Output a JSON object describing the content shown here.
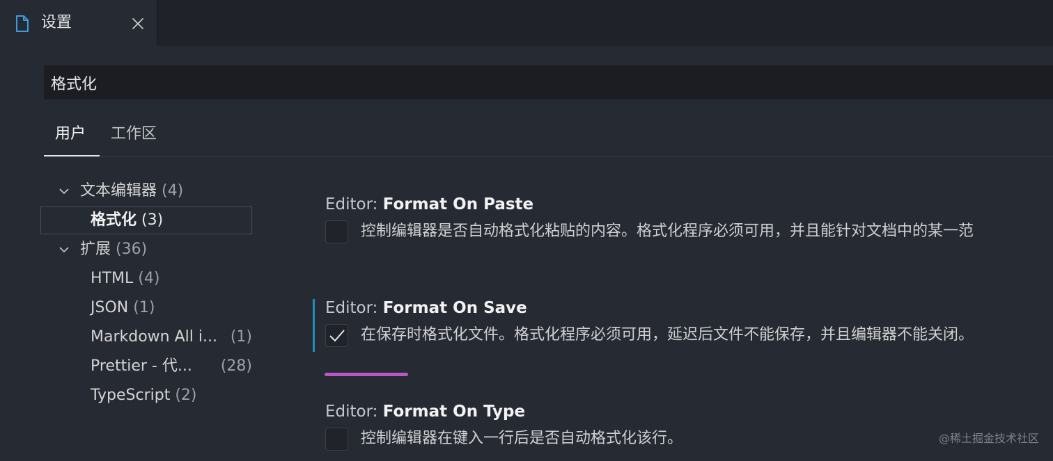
{
  "tab": {
    "title": "设置",
    "icon": "file-icon",
    "close_icon": "close-icon"
  },
  "search": {
    "value": "格式化"
  },
  "scope_tabs": [
    {
      "label": "用户",
      "active": true
    },
    {
      "label": "工作区",
      "active": false
    }
  ],
  "toc": [
    {
      "label": "文本编辑器",
      "count": "(4)",
      "expanded": true,
      "level": 0
    },
    {
      "label": "格式化",
      "count": "(3)",
      "level": 1,
      "selected": true
    },
    {
      "label": "扩展",
      "count": "(36)",
      "expanded": true,
      "level": 0
    },
    {
      "label": "HTML",
      "count": "(4)",
      "level": 1
    },
    {
      "label": "JSON",
      "count": "(1)",
      "level": 1
    },
    {
      "label": "Markdown All i...",
      "count": "(1)",
      "level": 1
    },
    {
      "label": "Prettier - 代...",
      "count": "(28)",
      "level": 1
    },
    {
      "label": "TypeScript",
      "count": "(2)",
      "level": 1
    }
  ],
  "settings": [
    {
      "category": "Editor: ",
      "name": "Format On Paste",
      "checked": false,
      "description": "控制编辑器是否自动格式化粘贴的内容。格式化程序必须可用，并且能针对文档中的某一范"
    },
    {
      "category": "Editor: ",
      "name": "Format On Save",
      "checked": true,
      "modified": true,
      "description": "在保存时格式化文件。格式化程序必须可用，延迟后文件不能保存，并且编辑器不能关闭。"
    },
    {
      "category": "Editor: ",
      "name": "Format On Type",
      "checked": false,
      "description": "控制编辑器在键入一行后是否自动格式化该行。"
    }
  ],
  "watermark": "@稀土掘金技术社区",
  "colors": {
    "background": "#262a33",
    "modified_indicator": "#1f8fb8",
    "accent_line": "#b659c6",
    "tab_icon": "#3b9de0"
  }
}
